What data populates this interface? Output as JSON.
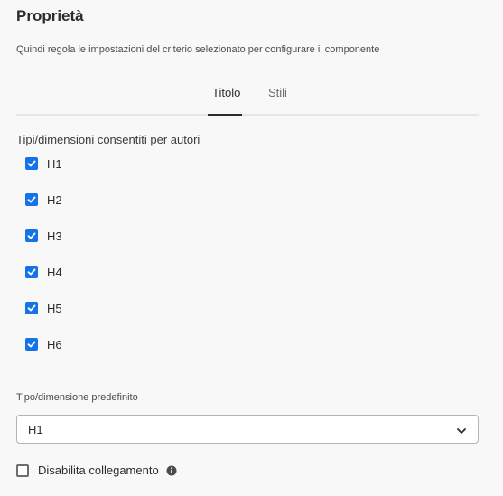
{
  "header": {
    "title": "Proprietà",
    "description": "Quindi regola le impostazioni del criterio selezionato per configurare il componente"
  },
  "tabs": [
    {
      "label": "Titolo",
      "active": true
    },
    {
      "label": "Stili",
      "active": false
    }
  ],
  "allowed_sizes": {
    "label": "Tipi/dimensioni consentiti per autori",
    "items": [
      {
        "label": "H1",
        "checked": true
      },
      {
        "label": "H2",
        "checked": true
      },
      {
        "label": "H3",
        "checked": true
      },
      {
        "label": "H4",
        "checked": true
      },
      {
        "label": "H5",
        "checked": true
      },
      {
        "label": "H6",
        "checked": true
      }
    ]
  },
  "default_size": {
    "label": "Tipo/dimensione predefinito",
    "value": "H1"
  },
  "disable_link": {
    "label": "Disabilita collegamento",
    "checked": false
  },
  "colors": {
    "accent": "#1473e6",
    "background": "#f8f8f8"
  }
}
